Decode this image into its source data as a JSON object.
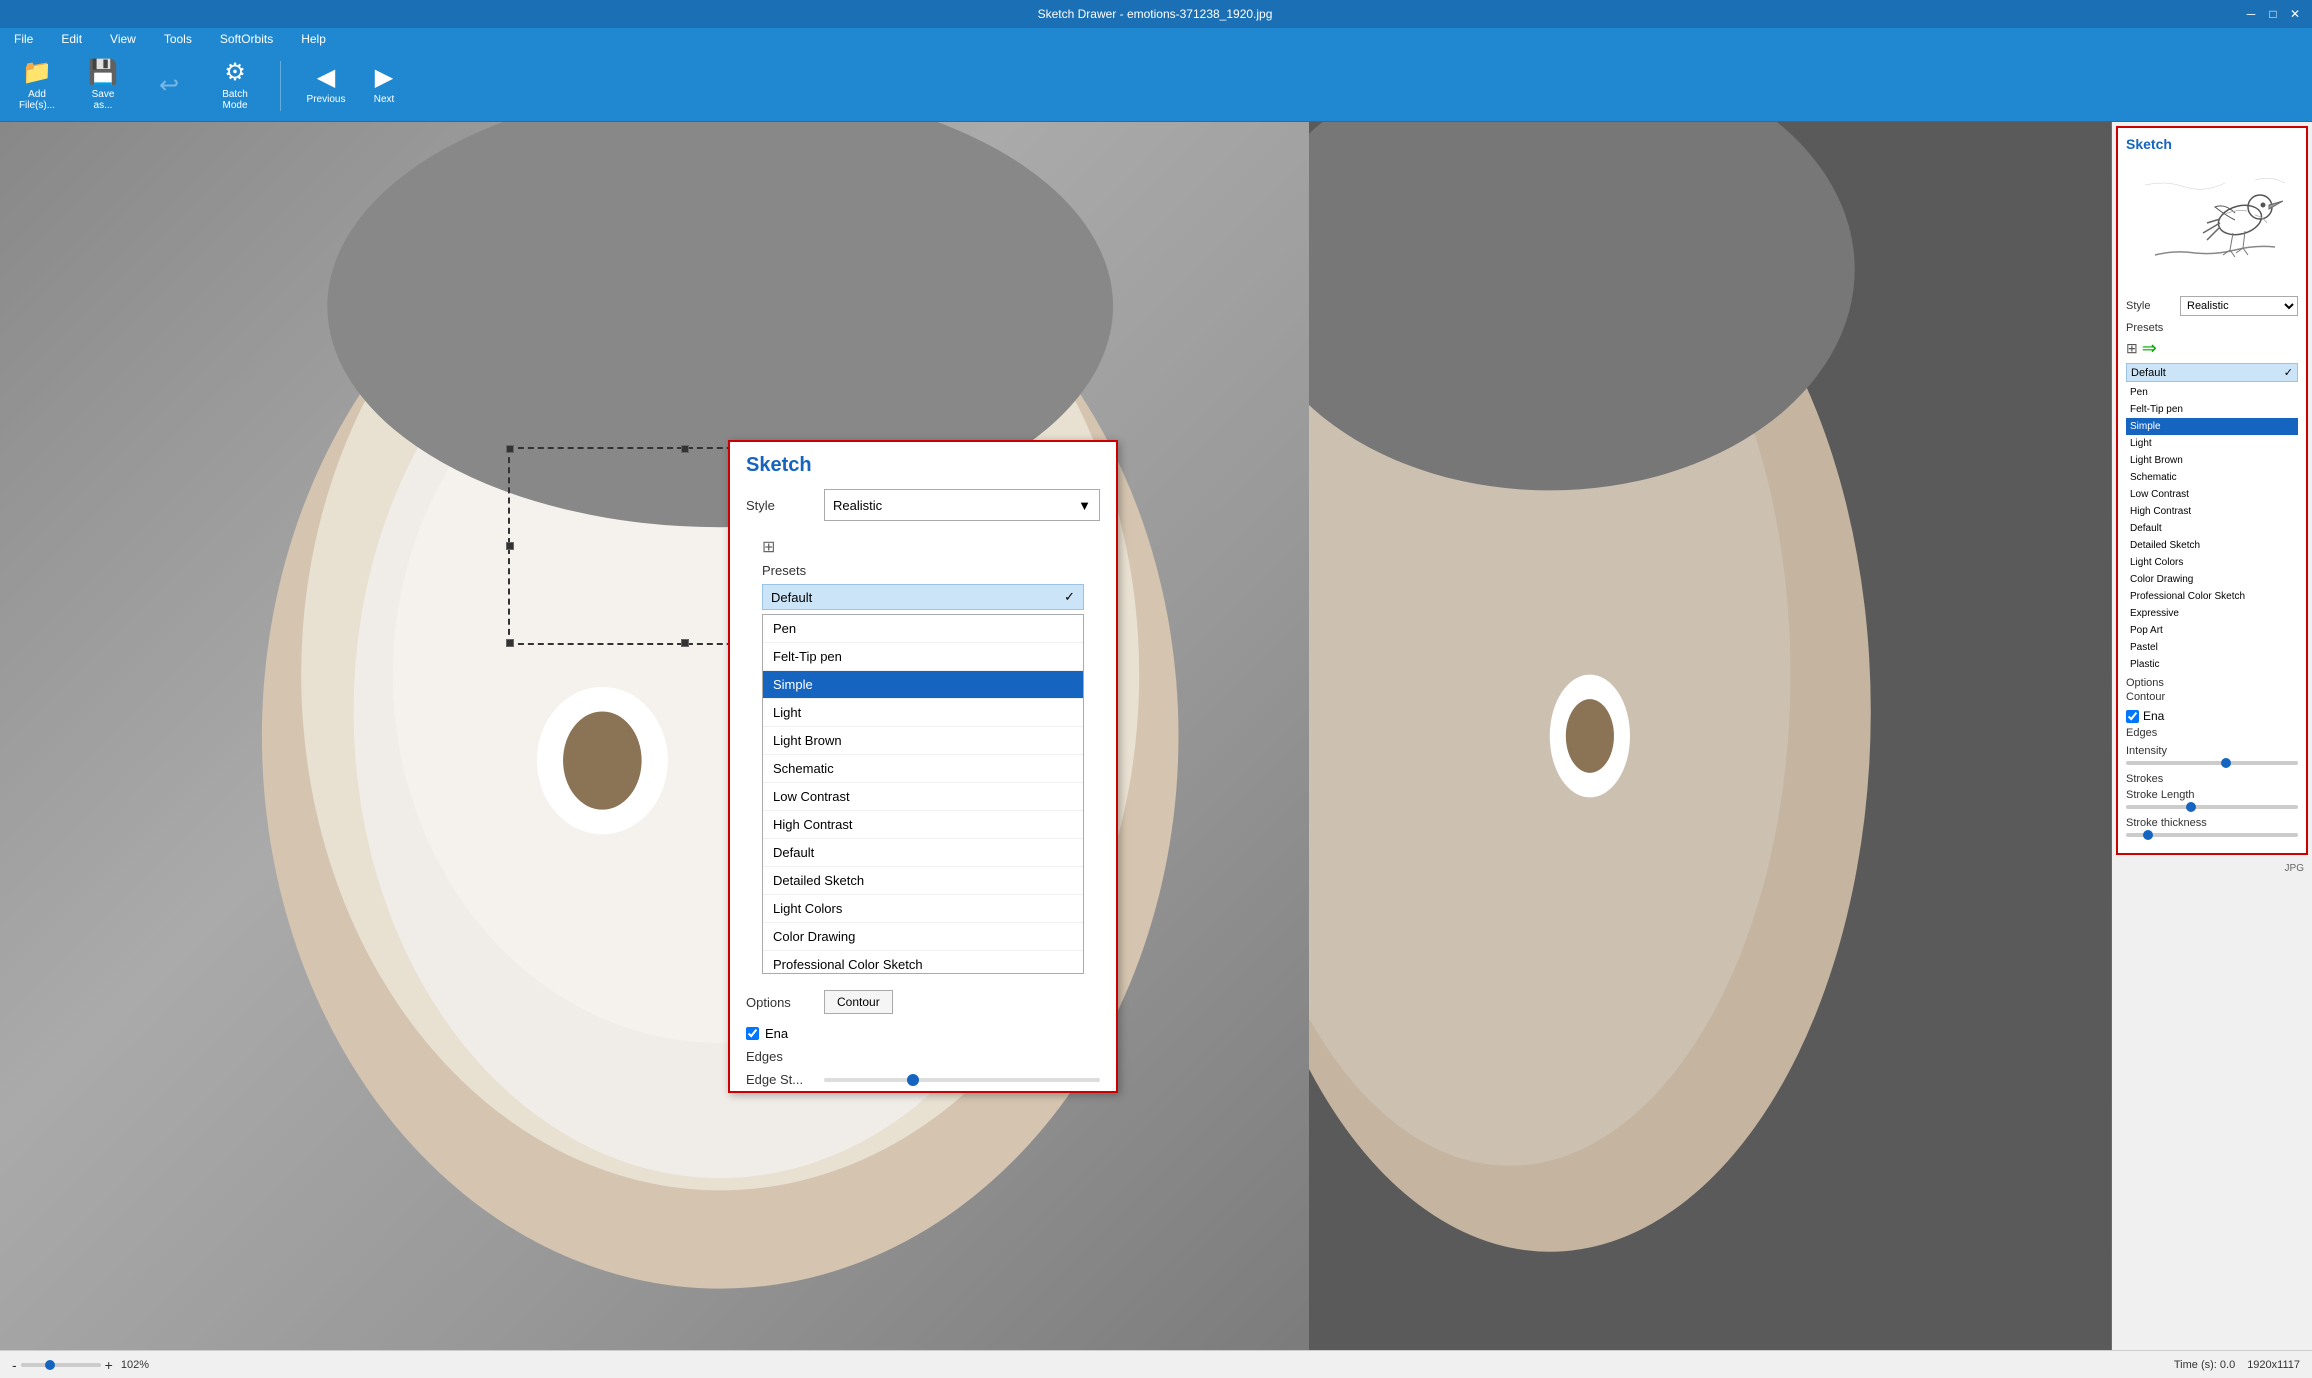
{
  "window": {
    "title": "Sketch Drawer - emotions-371238_1920.jpg",
    "controls": [
      "minimize",
      "maximize",
      "close"
    ]
  },
  "menubar": {
    "items": [
      "File",
      "Edit",
      "View",
      "Tools",
      "SoftOrbits",
      "Help"
    ]
  },
  "toolbar": {
    "add_files_label": "Add\nFile(s)...",
    "save_as_label": "Save\nas...",
    "batch_mode_label": "Batch\nMode",
    "previous_label": "Previous",
    "next_label": "Next"
  },
  "sketch_panel_large": {
    "title": "Sketch",
    "style_label": "Style",
    "style_value": "Realistic",
    "presets_label": "Presets",
    "default_preset": "Default",
    "options_label": "Options",
    "contour_btn": "Contour",
    "enable_label": "Ena",
    "edges_label": "Edges",
    "edge_strength_label": "Edge St...",
    "presets_list": [
      {
        "id": "pen",
        "label": "Pen",
        "selected": false
      },
      {
        "id": "felt-tip",
        "label": "Felt-Tip pen",
        "selected": false
      },
      {
        "id": "simple",
        "label": "Simple",
        "selected": true
      },
      {
        "id": "light",
        "label": "Light",
        "selected": false
      },
      {
        "id": "light-brown",
        "label": "Light Brown",
        "selected": false
      },
      {
        "id": "schematic",
        "label": "Schematic",
        "selected": false
      },
      {
        "id": "low-contrast",
        "label": "Low Contrast",
        "selected": false
      },
      {
        "id": "high-contrast",
        "label": "High Contrast",
        "selected": false
      },
      {
        "id": "default",
        "label": "Default",
        "selected": false
      },
      {
        "id": "detailed-sketch",
        "label": "Detailed Sketch",
        "selected": false
      },
      {
        "id": "light-colors",
        "label": "Light Colors",
        "selected": false
      },
      {
        "id": "color-drawing",
        "label": "Color Drawing",
        "selected": false
      },
      {
        "id": "professional-color",
        "label": "Professional Color Sketch",
        "selected": false
      },
      {
        "id": "expressive",
        "label": "Expressive",
        "selected": false
      },
      {
        "id": "pop-art",
        "label": "Pop Art",
        "selected": false
      },
      {
        "id": "pastel",
        "label": "Pastel",
        "selected": false
      },
      {
        "id": "plastic",
        "label": "Plastic",
        "selected": false
      }
    ]
  },
  "sketch_panel_mini": {
    "title": "Sketch",
    "style_label": "Style",
    "style_value": "Realistic",
    "presets_label": "Presets",
    "options_label": "Options",
    "contour_label": "Contour",
    "edges_label": "Edges",
    "enable_checkbox": true,
    "intensity_label": "Intensity",
    "strokes_label": "Strokes",
    "stroke_length_label": "Stroke Length",
    "stroke_thickness_label": "Stroke thickness",
    "mini_presets": [
      {
        "label": "Default"
      },
      {
        "label": "Pen"
      },
      {
        "label": "Felt-Tip pen"
      },
      {
        "label": "Simple",
        "selected": true
      },
      {
        "label": "Light"
      },
      {
        "label": "Light Brown"
      },
      {
        "label": "Schematic"
      },
      {
        "label": "Low Contrast"
      },
      {
        "label": "High Contrast"
      },
      {
        "label": "Default"
      },
      {
        "label": "Detailed Sketch"
      },
      {
        "label": "Light Colors"
      },
      {
        "label": "Color Drawing"
      },
      {
        "label": "Professional Color Sketch"
      },
      {
        "label": "Expressive"
      },
      {
        "label": "Pop Art"
      },
      {
        "label": "Pastel"
      },
      {
        "label": "Plastic"
      }
    ]
  },
  "status_bar": {
    "zoom_minus": "-",
    "zoom_plus": "+",
    "zoom_percent": "102%",
    "time_label": "Time (s): 0.0",
    "file_format": "JPG",
    "dimensions": "1920x1117"
  },
  "colors": {
    "accent_blue": "#1565c0",
    "toolbar_blue": "#2088d0",
    "red_border": "#cc0000",
    "selected_blue": "#1565c0",
    "preset_default_bg": "#cce4f7"
  }
}
